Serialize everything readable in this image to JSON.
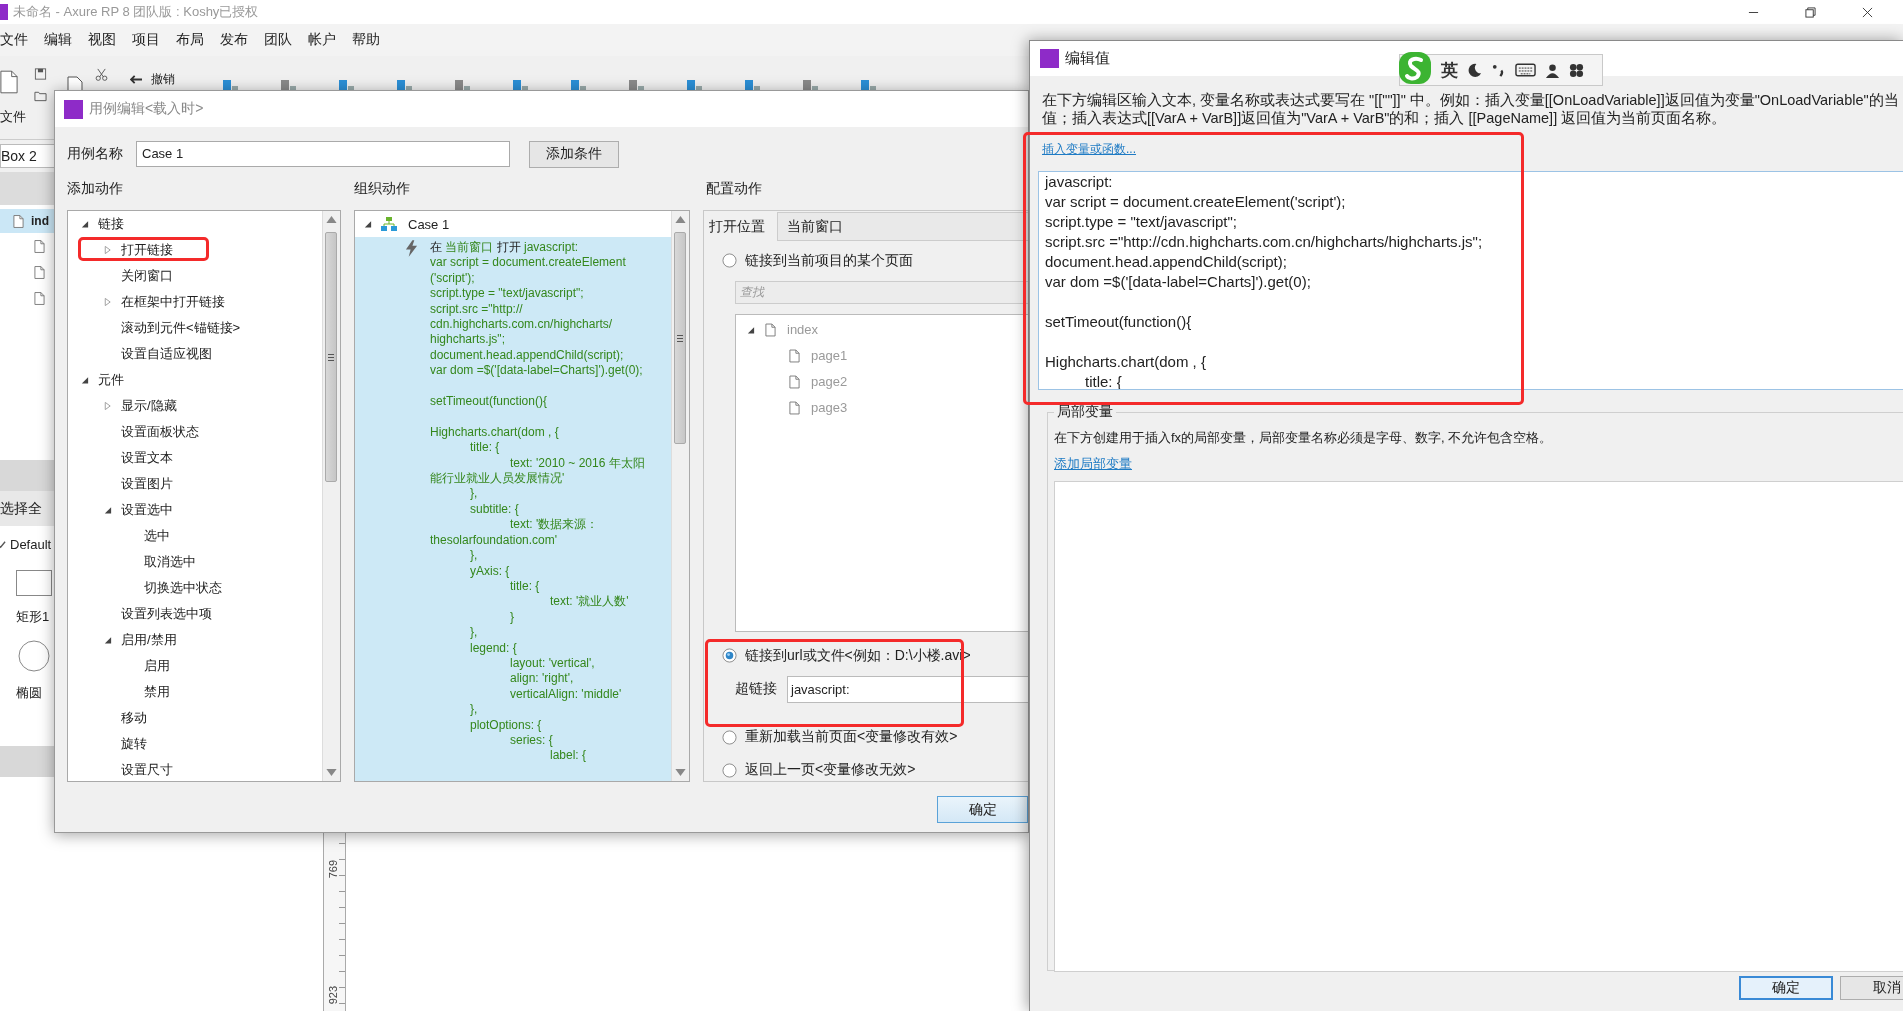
{
  "app": {
    "title": "未命名 - Axure RP 8 团队版 : Koshy已授权",
    "menu": [
      "文件",
      "编辑",
      "视图",
      "项目",
      "布局",
      "发布",
      "团队",
      "帐户",
      "帮助"
    ],
    "toolbar": {
      "file_label": "文件",
      "undo_label": "撤销"
    },
    "left_panel": {
      "search_value": "Box 2",
      "current_page": "ind",
      "library": "选择全",
      "library_name": "Default",
      "shapes": [
        {
          "kind": "rectangle",
          "label": "矩形1"
        },
        {
          "kind": "ellipse",
          "label": "椭圆"
        }
      ]
    },
    "ruler": {
      "marks": [
        "769",
        "923"
      ]
    }
  },
  "case_editor": {
    "title": "用例编辑<载入时>",
    "name_label": "用例名称",
    "name_value": "Case 1",
    "add_condition": "添加条件",
    "add_actions": {
      "heading": "添加动作",
      "items": [
        {
          "label": "链接",
          "kind": "branch",
          "expanded": true,
          "children": [
            {
              "label": "打开链接",
              "kind": "branch",
              "expanded": false,
              "highlighted": true
            },
            {
              "label": "关闭窗口",
              "kind": "leaf"
            },
            {
              "label": "在框架中打开链接",
              "kind": "branch",
              "expanded": false
            },
            {
              "label": "滚动到元件<锚链接>",
              "kind": "leaf"
            },
            {
              "label": "设置自适应视图",
              "kind": "leaf"
            }
          ]
        },
        {
          "label": "元件",
          "kind": "branch",
          "expanded": true,
          "children": [
            {
              "label": "显示/隐藏",
              "kind": "branch",
              "expanded": false
            },
            {
              "label": "设置面板状态",
              "kind": "leaf"
            },
            {
              "label": "设置文本",
              "kind": "leaf"
            },
            {
              "label": "设置图片",
              "kind": "leaf"
            },
            {
              "label": "设置选中",
              "kind": "branch",
              "expanded": true,
              "children": [
                {
                  "label": "选中",
                  "kind": "leaf"
                },
                {
                  "label": "取消选中",
                  "kind": "leaf"
                },
                {
                  "label": "切换选中状态",
                  "kind": "leaf"
                }
              ]
            },
            {
              "label": "设置列表选中项",
              "kind": "leaf"
            },
            {
              "label": "启用/禁用",
              "kind": "branch",
              "expanded": true,
              "children": [
                {
                  "label": "启用",
                  "kind": "leaf"
                },
                {
                  "label": "禁用",
                  "kind": "leaf"
                }
              ]
            },
            {
              "label": "移动",
              "kind": "leaf"
            },
            {
              "label": "旋转",
              "kind": "leaf"
            },
            {
              "label": "设置尺寸",
              "kind": "leaf"
            }
          ]
        }
      ]
    },
    "organize": {
      "heading": "组织动作",
      "case": {
        "name": "Case 1",
        "expanded": true
      },
      "action_parts": [
        {
          "text": "在",
          "kind": "plain"
        },
        {
          "text": "当前窗口",
          "kind": "value"
        },
        {
          "text": "打开",
          "kind": "plain"
        },
        {
          "text": "javascript:",
          "kind": "value"
        }
      ],
      "code_blocks": [
        [
          "var script = document.createElement",
          "('script');",
          "script.type = \"text/javascript\";",
          "script.src =\"http://",
          "cdn.highcharts.com.cn/highcharts/",
          "highcharts.js\";",
          "document.head.appendChild(script);",
          "var dom =$('[data-label=Charts]').get(0);"
        ],
        [
          "setTimeout(function(){"
        ],
        [
          "Highcharts.chart(dom , {",
          "\ttitle: {",
          "\t\ttext: '2010 ~ 2016 年太阳",
          "能行业就业人员发展情况'",
          "\t},",
          "\tsubtitle: {",
          "\t\ttext: '数据来源：",
          "thesolarfoundation.com'",
          "\t},",
          "\tyAxis: {",
          "\t\ttitle: {",
          "\t\t\ttext: '就业人数'",
          "\t\t}",
          "\t},",
          "\tlegend: {",
          "\t\tlayout: 'vertical',",
          "\t\talign: 'right',",
          "\t\tverticalAlign: 'middle'",
          "\t},",
          "\tplotOptions: {",
          "\t\tseries: {",
          "\t\t\tlabel: {"
        ]
      ]
    },
    "configure": {
      "heading": "配置动作",
      "open_in_label": "打开位置",
      "open_in_value": "当前窗口",
      "page_link": {
        "label": "链接到当前项目的某个页面",
        "selected": false,
        "search_placeholder": "查找",
        "tree": {
          "label": "index",
          "expanded": true,
          "children": [
            {
              "label": "page1"
            },
            {
              "label": "page2"
            },
            {
              "label": "page3"
            }
          ]
        }
      },
      "url_link": {
        "label": "链接到url或文件<例如：D:\\小楼.avi>",
        "selected": true,
        "highlighted": true,
        "hyperlink_label": "超链接",
        "hyperlink_value": "javascript:"
      },
      "other_options": [
        {
          "label": "重新加载当前页面<变量修改有效>",
          "selected": false
        },
        {
          "label": "返回上一页<变量修改无效>",
          "selected": false
        }
      ]
    },
    "ok": "确定"
  },
  "value_editor": {
    "title": "编辑值",
    "description": [
      "在下方编辑区输入文本, 变量名称或表达式要写在 \"[[\"\"]]\" 中。例如：插入变量[[OnLoadVariable]]返回值为变量\"OnLoadVariable\"的当",
      "值；插入表达式[[VarA + VarB]]返回值为\"VarA + VarB\"的和；插入 [[PageName]] 返回值为当前页面名称。"
    ],
    "insert_link": "插入变量或函数...",
    "highlighted": true,
    "code_blocks": [
      [
        "javascript:",
        "var script = document.createElement('script');",
        "script.type = \"text/javascript\";",
        "script.src =\"http://cdn.highcharts.com.cn/highcharts/highcharts.js\";",
        "document.head.appendChild(script);",
        "var dom =$('[data-label=Charts]').get(0);"
      ],
      [
        "setTimeout(function(){"
      ],
      [
        "Highcharts.chart(dom , {",
        "\ttitle: {"
      ]
    ],
    "locals": {
      "legend": "局部变量",
      "hint": "在下方创建用于插入fx的局部变量，局部变量名称必须是字母、数字, 不允许包含空格。",
      "add_link": "添加局部变量"
    },
    "buttons": [
      {
        "label": "确定",
        "kind": "primary"
      },
      {
        "label": "取消",
        "kind": "secondary"
      }
    ]
  },
  "ime_bar": {
    "mode": "英"
  }
}
